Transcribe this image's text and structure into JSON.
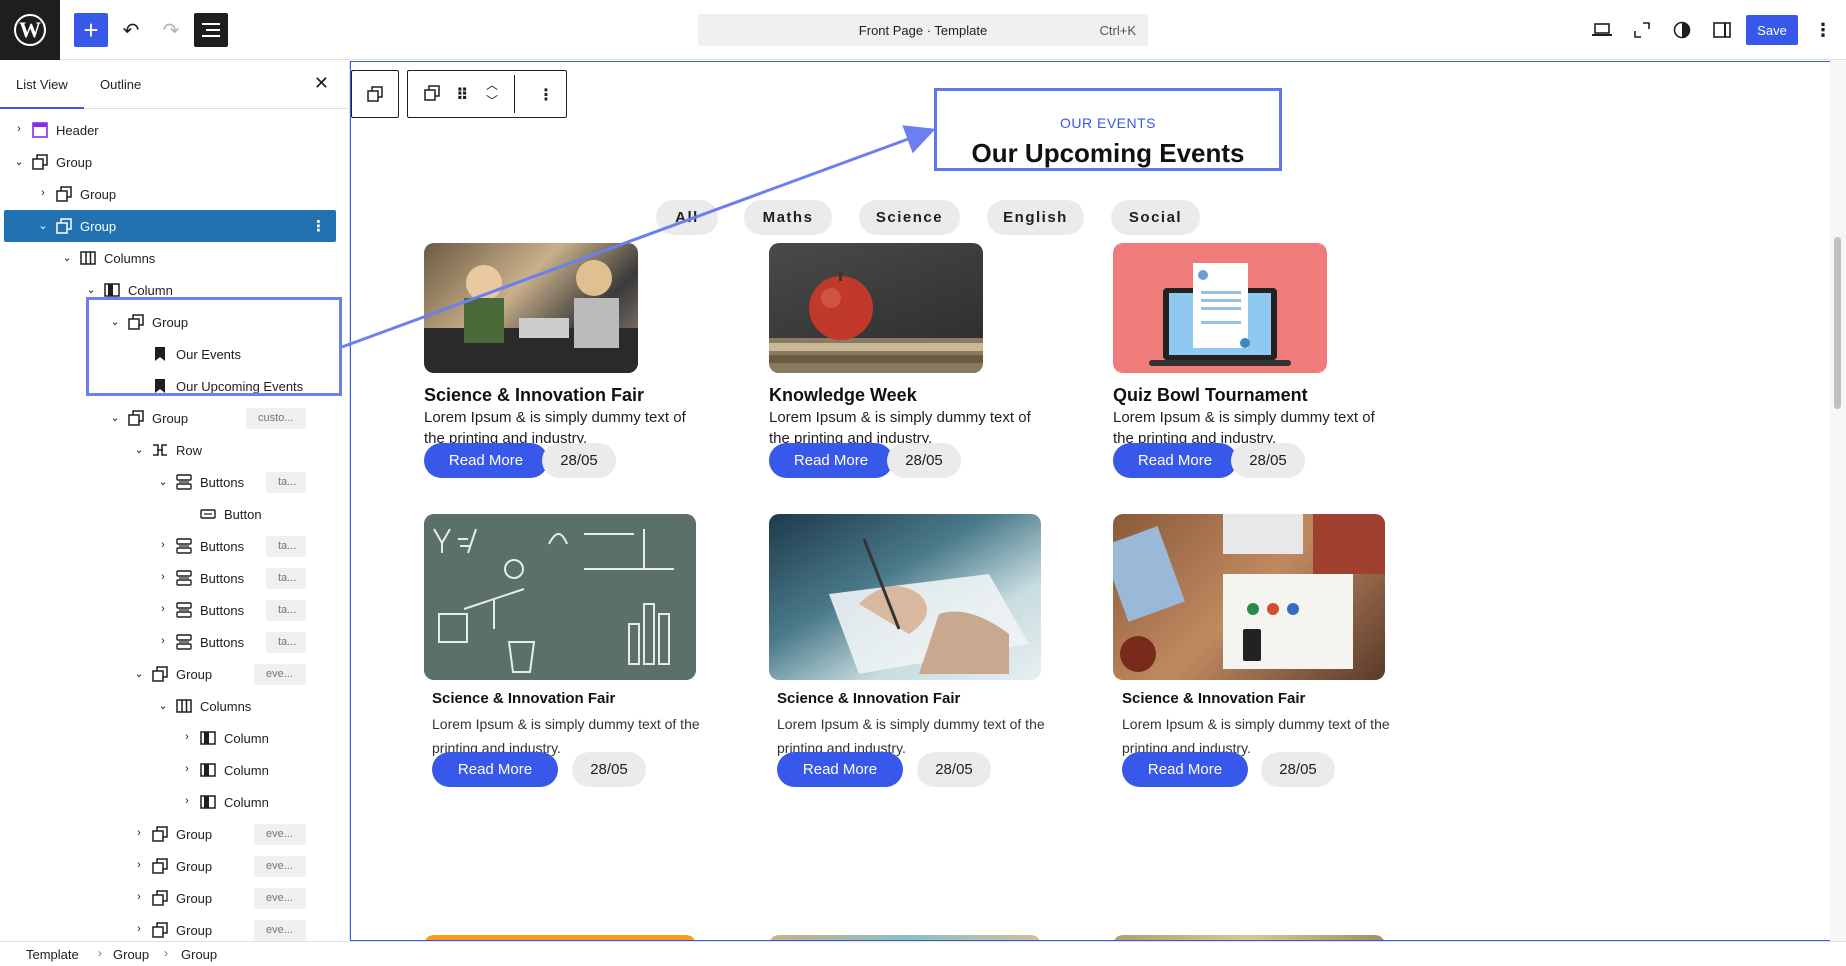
{
  "topbar": {
    "logo": "W",
    "command_title": "Front Page · Template",
    "command_shortcut": "Ctrl+K",
    "save_label": "Save",
    "icons": [
      "plus-icon",
      "undo-icon",
      "redo-icon",
      "list-view-icon",
      "desktop-icon",
      "fullscreen-icon",
      "styles-icon",
      "sidebar-icon",
      "more-vertical-icon"
    ]
  },
  "sidebar": {
    "tabs": [
      "List View",
      "Outline"
    ],
    "tree": [
      {
        "label": "Header",
        "badge": ""
      },
      {
        "label": "Group",
        "badge": ""
      },
      {
        "label": "Group",
        "badge": ""
      },
      {
        "label": "Group",
        "badge": ""
      },
      {
        "label": "Columns",
        "badge": ""
      },
      {
        "label": "Column",
        "badge": ""
      },
      {
        "label": "Group",
        "badge": ""
      },
      {
        "label": "Our Events",
        "badge": ""
      },
      {
        "label": "Our Upcoming Events",
        "badge": ""
      },
      {
        "label": "Group",
        "badge": "custo..."
      },
      {
        "label": "Row",
        "badge": ""
      },
      {
        "label": "Buttons",
        "badge": "ta..."
      },
      {
        "label": "Button",
        "badge": ""
      },
      {
        "label": "Buttons",
        "badge": "ta..."
      },
      {
        "label": "Buttons",
        "badge": "ta..."
      },
      {
        "label": "Buttons",
        "badge": "ta..."
      },
      {
        "label": "Buttons",
        "badge": "ta..."
      },
      {
        "label": "Group",
        "badge": "eve..."
      },
      {
        "label": "Columns",
        "badge": ""
      },
      {
        "label": "Column",
        "badge": ""
      },
      {
        "label": "Column",
        "badge": ""
      },
      {
        "label": "Column",
        "badge": ""
      },
      {
        "label": "Group",
        "badge": "eve..."
      },
      {
        "label": "Group",
        "badge": "eve..."
      },
      {
        "label": "Group",
        "badge": "eve..."
      },
      {
        "label": "Group",
        "badge": "eve..."
      }
    ]
  },
  "breadcrumb": [
    "Template",
    "Group",
    "Group"
  ],
  "canvas": {
    "eyebrow": "OUR EVENTS",
    "heading": "Our Upcoming Events",
    "filters": [
      "All",
      "Maths",
      "Science",
      "English",
      "Social"
    ],
    "cards": [
      {
        "title": "Science & Innovation Fair",
        "desc": "Lorem Ipsum & is simply dummy text of the printing and industry.",
        "button": "Read More",
        "date": "28/05"
      },
      {
        "title": "Knowledge Week",
        "desc": "Lorem Ipsum & is simply dummy text of the printing and industry.",
        "button": "Read More",
        "date": "28/05"
      },
      {
        "title": "Quiz Bowl Tournament",
        "desc": "Lorem Ipsum & is simply dummy text of the printing and industry.",
        "button": "Read More",
        "date": "28/05"
      },
      {
        "title": "Science & Innovation Fair",
        "desc": "Lorem Ipsum & is simply dummy text of the printing and industry.",
        "button": "Read More",
        "date": "28/05"
      },
      {
        "title": "Science & Innovation Fair",
        "desc": "Lorem Ipsum & is simply dummy text of the printing and industry.",
        "button": "Read More",
        "date": "28/05"
      },
      {
        "title": "Science & Innovation Fair",
        "desc": "Lorem Ipsum & is simply dummy text of the printing and industry.",
        "button": "Read More",
        "date": "28/05"
      }
    ]
  },
  "colors": {
    "accent": "#3858e9",
    "selected_row": "#2271b1",
    "annotation": "#6b7ff0"
  }
}
